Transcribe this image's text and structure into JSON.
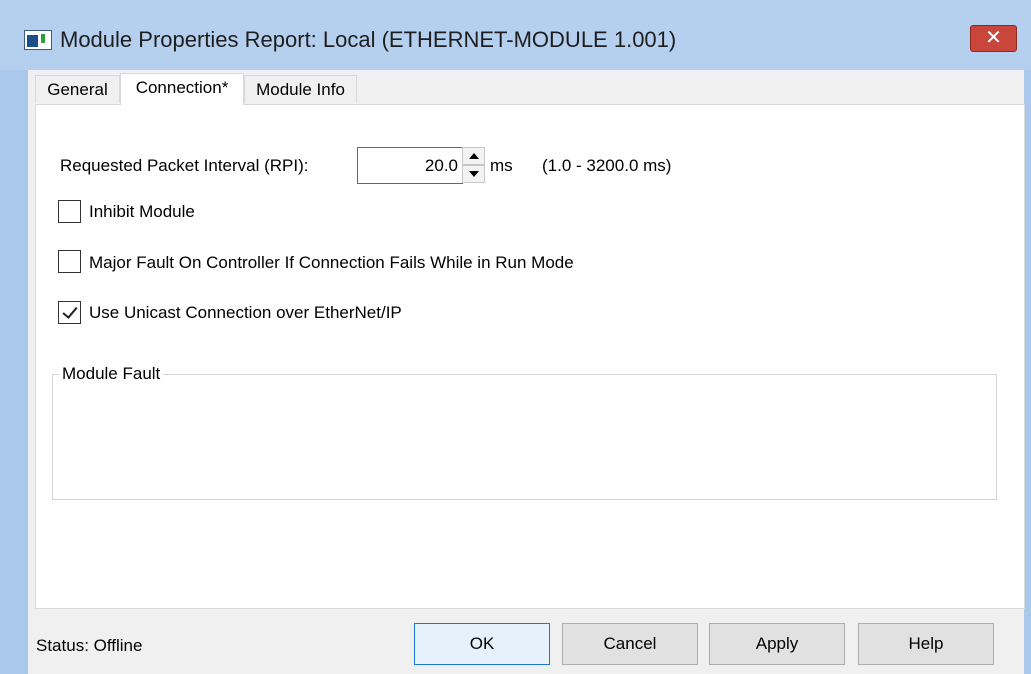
{
  "window": {
    "title": "Module Properties Report: Local (ETHERNET-MODULE 1.001)",
    "close_label": "✕"
  },
  "tabs": [
    {
      "label": "General",
      "active": false
    },
    {
      "label": "Connection*",
      "active": true
    },
    {
      "label": "Module Info",
      "active": false
    }
  ],
  "connection": {
    "rpi_label": "Requested Packet Interval (RPI):",
    "rpi_value": "20.0",
    "rpi_unit": "ms",
    "rpi_range": "(1.0 - 3200.0 ms)",
    "inhibit_label": "Inhibit Module",
    "inhibit_checked": false,
    "major_fault_label": "Major Fault On Controller If Connection Fails While in Run Mode",
    "major_fault_checked": false,
    "unicast_label": "Use Unicast Connection over EtherNet/IP",
    "unicast_checked": true,
    "module_fault_legend": "Module Fault"
  },
  "status": {
    "text": "Status:  Offline"
  },
  "buttons": {
    "ok": "OK",
    "cancel": "Cancel",
    "apply": "Apply",
    "help": "Help"
  }
}
